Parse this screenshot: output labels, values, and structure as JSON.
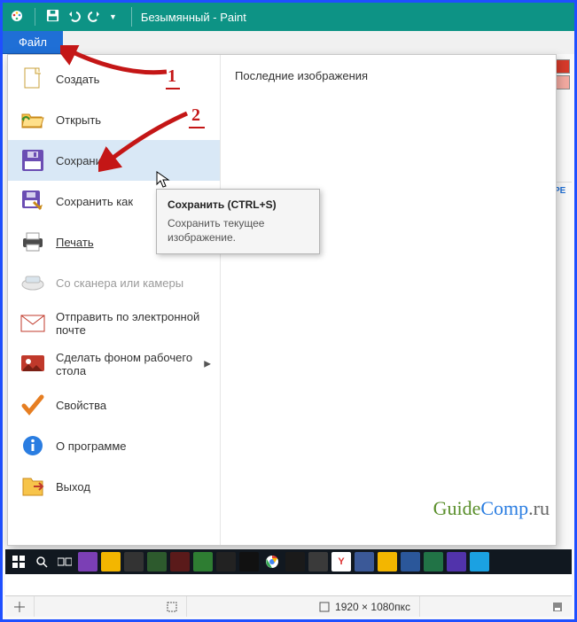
{
  "window": {
    "title": "Безымянный - Paint"
  },
  "file_tab": {
    "label": "Файл"
  },
  "recent": {
    "title": "Последние изображения"
  },
  "menu": {
    "create": "Создать",
    "open": "Открыть",
    "save": "Сохранить",
    "save_as": "Сохранить как",
    "print": "Печать",
    "scanner": "Со сканера или камеры",
    "email": "Отправить по электронной почте",
    "wallpaper": "Сделать фоном рабочего стола",
    "properties": "Свойства",
    "about": "О программе",
    "exit": "Выход"
  },
  "tooltip": {
    "title": "Сохранить (CTRL+S)",
    "body": "Сохранить текущее изображение."
  },
  "annotations": {
    "one": "1",
    "two": "2"
  },
  "sidebar": {
    "rsel": "РЕ"
  },
  "statusbar": {
    "dims": "1920 × 1080пкс"
  },
  "watermark": {
    "text_guide": "Guide",
    "text_comp": "Comp",
    "text_ru": ".ru"
  }
}
